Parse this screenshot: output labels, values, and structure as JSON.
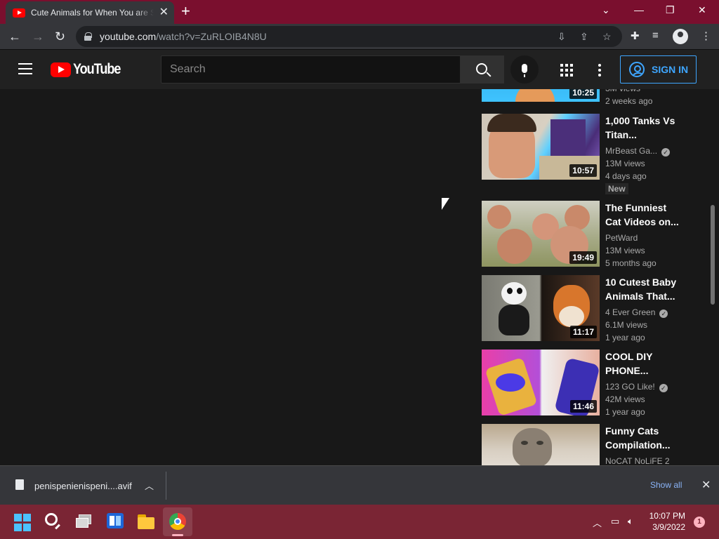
{
  "browser": {
    "tab_title": "Cute Animals for When You are Sad",
    "tab_close": "✕",
    "new_tab": "+",
    "url_domain": "youtube.com",
    "url_path": "/watch?v=ZuRLOIB4N8U",
    "window_controls": {
      "minimize": "—",
      "restore": "❐",
      "close": "✕",
      "dropdown": "⌄"
    }
  },
  "yt_header": {
    "logo_text": "YouTube",
    "search_placeholder": "Search",
    "signin_label": "SIGN IN"
  },
  "related_videos": [
    {
      "duration": "10:25",
      "title": "",
      "channel": "",
      "views": "3M views",
      "age": "2 weeks ago",
      "verified": false,
      "badge": ""
    },
    {
      "duration": "10:57",
      "title": "1,000 Tanks Vs Titan...",
      "channel": "MrBeast Ga...",
      "views": "13M views",
      "age": "4 days ago",
      "verified": true,
      "badge": "New"
    },
    {
      "duration": "19:49",
      "title": "The Funniest Cat Videos on...",
      "channel": "PetWard",
      "views": "13M views",
      "age": "5 months ago",
      "verified": false,
      "badge": ""
    },
    {
      "duration": "11:17",
      "title": "10 Cutest Baby Animals That...",
      "channel": "4 Ever Green",
      "views": "6.1M views",
      "age": "1 year ago",
      "verified": true,
      "badge": ""
    },
    {
      "duration": "11:46",
      "title": "COOL DIY PHONE...",
      "channel": "123 GO Like!",
      "views": "42M views",
      "age": "1 year ago",
      "verified": true,
      "badge": ""
    },
    {
      "duration": "",
      "title": "Funny Cats Compilation...",
      "channel": "NoCAT NoLiFE 2",
      "views": "",
      "age": "",
      "verified": false,
      "badge": ""
    }
  ],
  "downloads": {
    "file_name": "penispenienispeni....avif",
    "show_all": "Show all"
  },
  "taskbar": {
    "time": "10:07 PM",
    "date": "3/9/2022",
    "notification_count": "1"
  }
}
